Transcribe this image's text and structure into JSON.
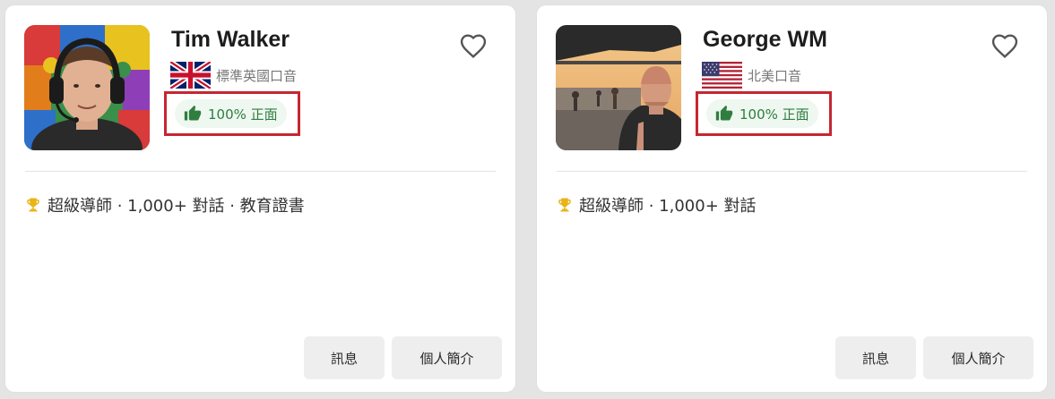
{
  "tutors": [
    {
      "name": "Tim Walker",
      "accent": "標準英國口音",
      "rating": "100% 正面",
      "badges": "超級導師 · 1,000+ 對話 · 教育證書",
      "message_label": "訊息",
      "profile_label": "個人簡介",
      "flag_icon": "uk-flag-icon"
    },
    {
      "name": "George WM",
      "accent": "北美口音",
      "rating": "100% 正面",
      "badges": "超級導師 · 1,000+ 對話",
      "message_label": "訊息",
      "profile_label": "個人簡介",
      "flag_icon": "us-flag-icon"
    }
  ],
  "colors": {
    "page_bg": "#e4e4e4",
    "card_bg": "#ffffff",
    "highlight_border": "#c62631",
    "rating_text": "#2f7d3f",
    "rating_bg": "#eef7f0",
    "trophy": "#e8b417",
    "button_bg": "#eeeeee"
  }
}
